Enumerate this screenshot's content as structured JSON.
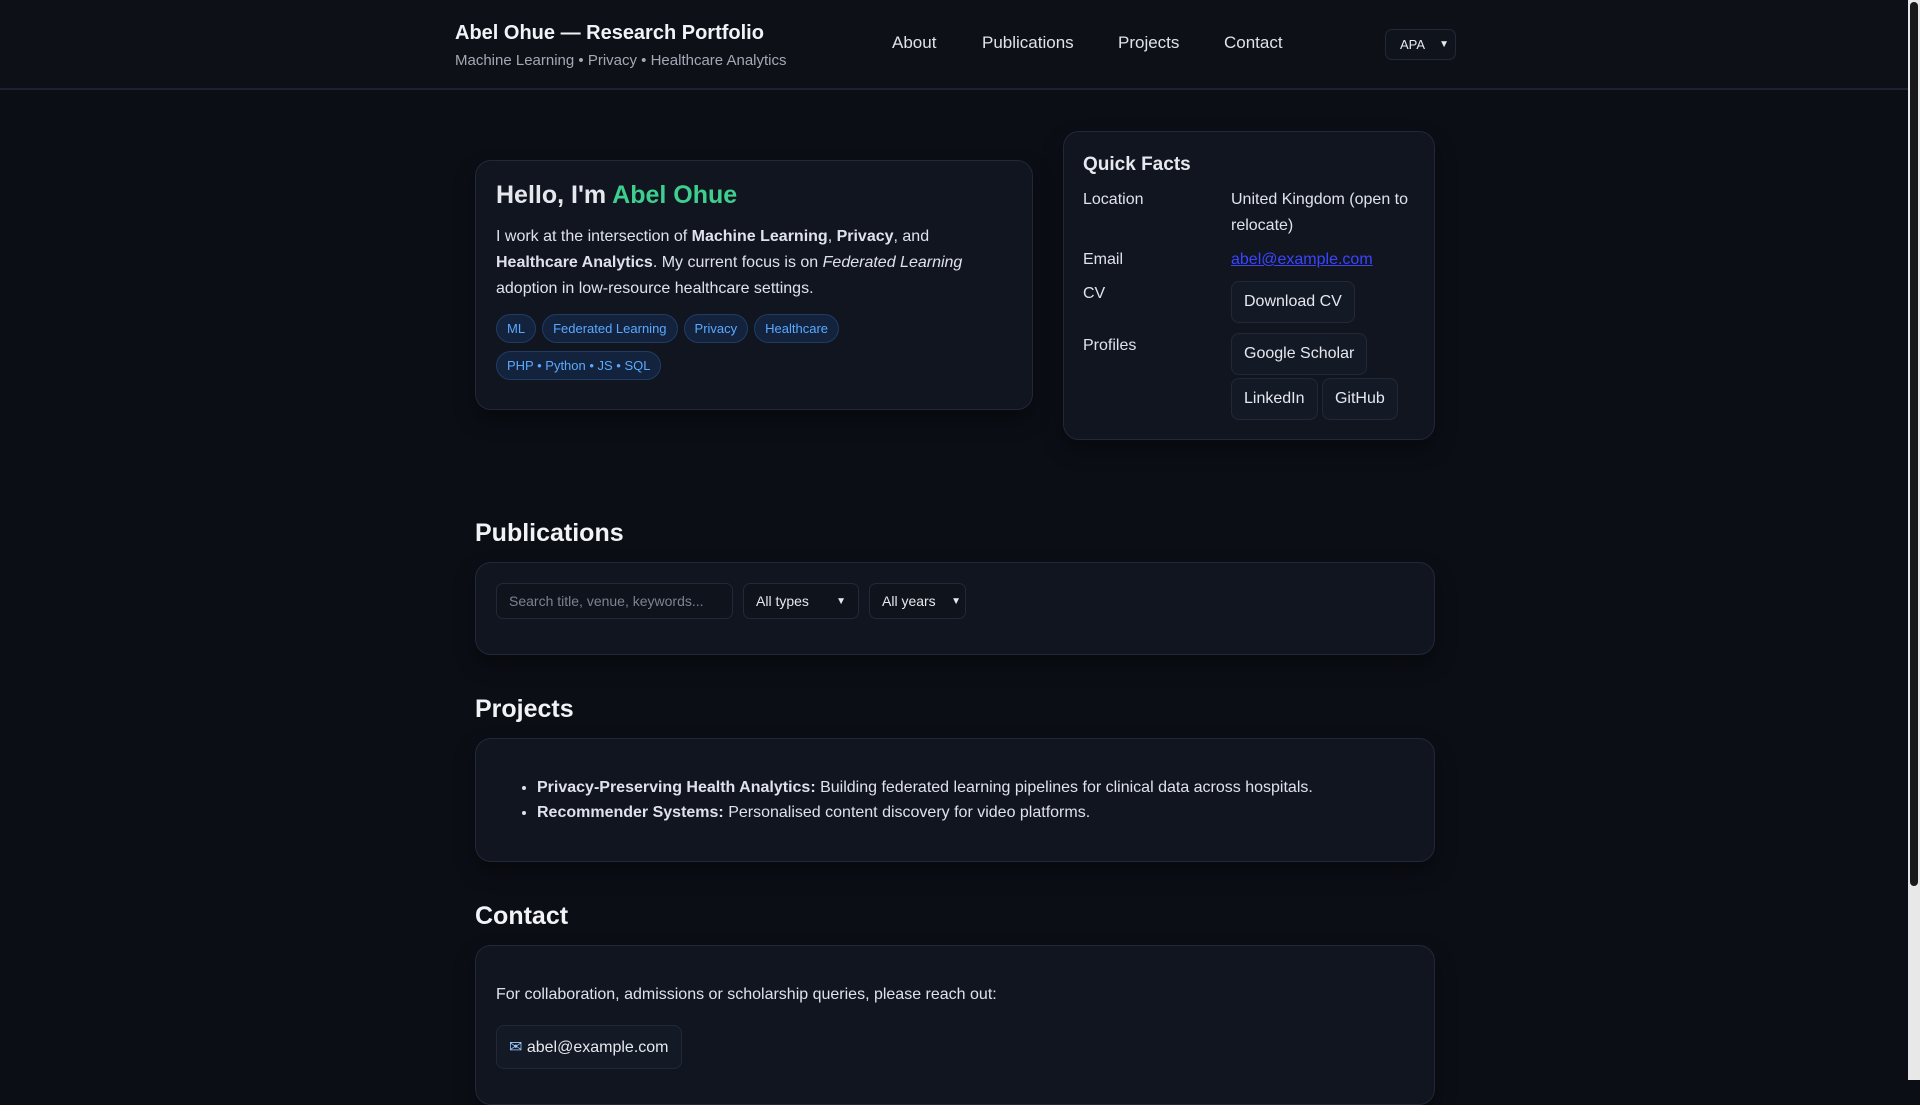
{
  "header": {
    "title": "Abel Ohue — Research Portfolio",
    "subtitle": "Machine Learning • Privacy • Healthcare Analytics",
    "nav": [
      "About",
      "Publications",
      "Projects",
      "Contact"
    ],
    "citation_style": "APA"
  },
  "hero": {
    "greeting": "Hello, I'm ",
    "name": "Abel Ohue",
    "intro_1": "I work at the intersection of ",
    "b1": "Machine Learning",
    "sep1": ", ",
    "b2": "Privacy",
    "sep2": ", and ",
    "b3": "Healthcare Analytics",
    "intro_2": ". My current focus is on ",
    "i1": "Federated Learning",
    "intro_3": " adoption in low-resource healthcare settings.",
    "tags": [
      "ML",
      "Federated Learning",
      "Privacy",
      "Healthcare"
    ],
    "skills": "PHP • Python • JS • SQL"
  },
  "quick_facts": {
    "title": "Quick Facts",
    "location_label": "Location",
    "location": "United Kingdom (open to relocate)",
    "email_label": "Email",
    "email": "abel@example.com",
    "cv_label": "CV",
    "cv_button": "Download CV",
    "profiles_label": "Profiles",
    "profiles": [
      "Google Scholar",
      "LinkedIn",
      "GitHub"
    ]
  },
  "publications": {
    "heading": "Publications",
    "search_placeholder": "Search title, venue, keywords...",
    "type_filter": "All types",
    "year_filter": "All years"
  },
  "projects": {
    "heading": "Projects",
    "items": [
      {
        "title": "Privacy-Preserving Health Analytics:",
        "desc": " Building federated learning pipelines for clinical data across hospitals."
      },
      {
        "title": "Recommender Systems:",
        "desc": " Personalised content discovery for video platforms."
      }
    ]
  },
  "contact": {
    "heading": "Contact",
    "text": "For collaboration, admissions or scholarship queries, please reach out:",
    "email_button": "abel@example.com"
  },
  "colors": {
    "accent": "#3ecf8e",
    "chip": "#5aa9ff",
    "link": "#3b45ff"
  }
}
